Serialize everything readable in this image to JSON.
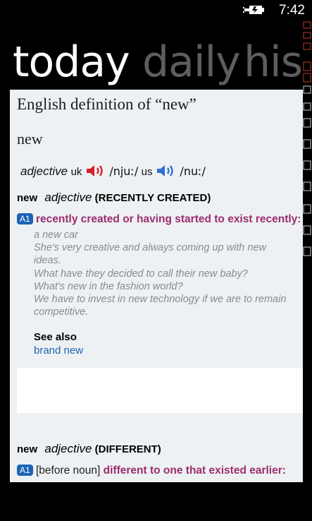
{
  "status": {
    "time": "7:42",
    "battery_icon": "battery-charging-icon"
  },
  "pivot": {
    "items": [
      "today",
      "daily",
      "his"
    ]
  },
  "entry": {
    "page_title": "English definition of “new”",
    "headword": "new",
    "pronunciation": {
      "pos": "adjective",
      "uk_label": "uk",
      "uk_ipa": "/njuː/",
      "us_label": "us",
      "us_ipa": "/nuː/"
    },
    "senses": [
      {
        "word": "new",
        "pos": "adjective",
        "guide": "(RECENTLY CREATED)",
        "level": "A1",
        "grammar": "",
        "definition": "recently created or having started to exist recently:",
        "examples": [
          "a new car",
          "She's very creative and always coming up with new ideas.",
          "What have they decided to call their new baby?",
          "What's new in the fashion world?",
          "We have to invest in new technology if we are to remain competitive."
        ],
        "see_also_label": "See also",
        "see_also_link": "brand new"
      },
      {
        "word": "new",
        "pos": "adjective",
        "guide": "(DIFFERENT)",
        "level": "A1",
        "grammar": "[before noun]",
        "definition": "different to one that existed earlier:"
      }
    ]
  },
  "colors": {
    "definition": "#9c2d6e",
    "link": "#1b64b4",
    "badge": "#1b64b4",
    "uk_speaker": "#d81e2a",
    "us_speaker": "#2e6fd8"
  }
}
